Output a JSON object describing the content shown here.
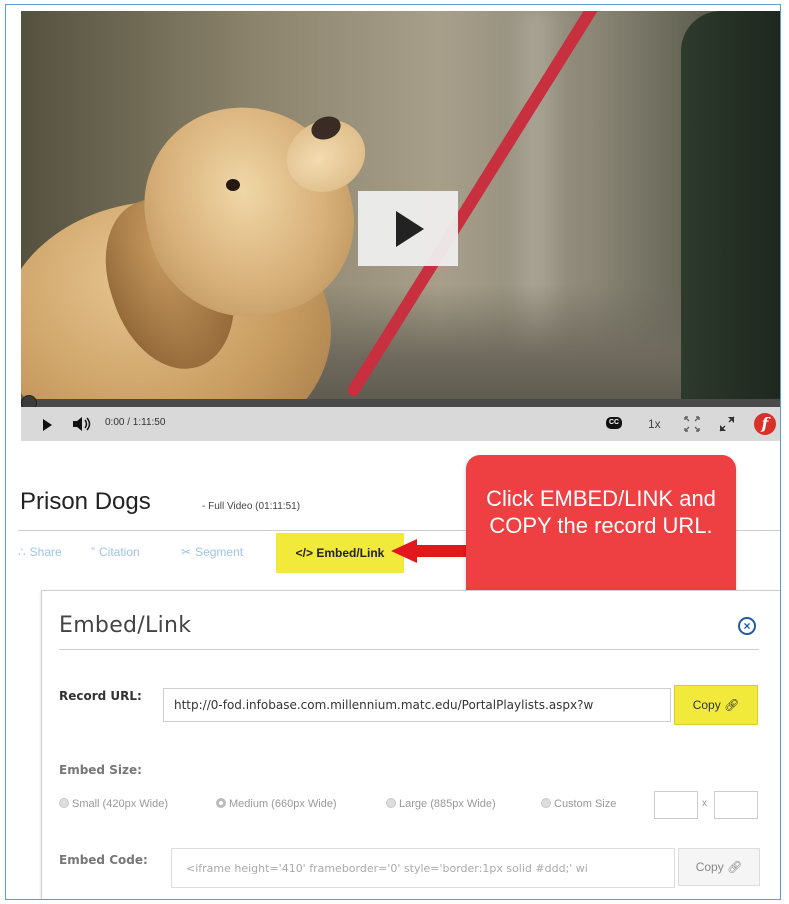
{
  "player": {
    "time_text": "0:00  / 1:11:50",
    "cc_label": "CC",
    "speed_label": "1x",
    "progress_fraction": 0.0
  },
  "video": {
    "title": "Prison Dogs",
    "subtitle": "- Full Video (01:11:51)"
  },
  "tabs": {
    "share": "Share",
    "citation": "Citation",
    "segment": "Segment",
    "embed": "Embed/Link"
  },
  "callout": {
    "text": "Click EMBED/LINK and COPY the record URL.",
    "color": "#ee3f43"
  },
  "panel": {
    "title": "Embed/Link",
    "record_url_label": "Record URL:",
    "record_url_value": "http://0-fod.infobase.com.millennium.matc.edu/PortalPlaylists.aspx?w",
    "copy_label": "Copy",
    "embed_size_label": "Embed Size:",
    "size_options": [
      "Small (420px Wide)",
      "Medium (660px Wide)",
      "Large (885px Wide)",
      "Custom Size"
    ],
    "selected_size": "Medium (660px Wide)",
    "dim_separator": "x",
    "embed_code_label": "Embed Code:",
    "embed_code_value": "<iframe height='410' frameborder='0' style='border:1px solid #ddd;' wi",
    "embed_copy_label": "Copy"
  },
  "colors": {
    "highlight_yellow": "#f2ea3b",
    "link_blue": "#9cc4e6",
    "close_blue": "#1e5aa8",
    "brand_red": "#d9302a"
  },
  "icons": [
    "play-icon",
    "volume-icon",
    "closed-caption-icon",
    "expand-icon",
    "fullscreen-icon",
    "brand-logo",
    "share-icon",
    "citation-icon",
    "scissors-icon",
    "code-icon",
    "close-icon",
    "link-icon"
  ]
}
